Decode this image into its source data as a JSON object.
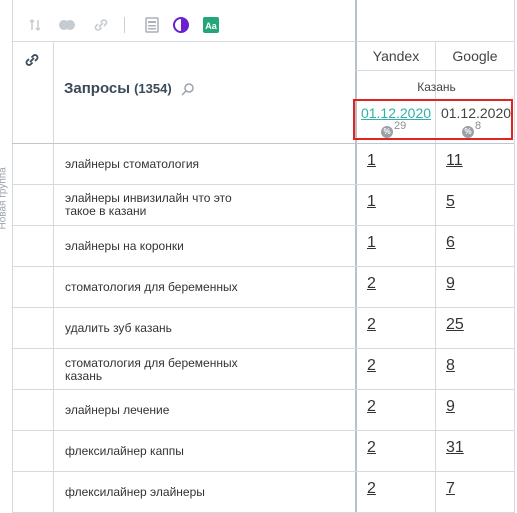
{
  "sidebar": {
    "group_label": "Новая группа"
  },
  "header": {
    "title": "Запросы",
    "count": "(1354)"
  },
  "engines": [
    {
      "label": "Yandex"
    },
    {
      "label": "Google"
    }
  ],
  "region": "Казань",
  "dates": [
    {
      "value": "01.12.2020",
      "percent_value": "29"
    },
    {
      "value": "01.12.2020",
      "percent_value": "8"
    }
  ],
  "percent_symbol": "%",
  "rows": [
    {
      "query": "элайнеры стоматология",
      "yandex": "1",
      "google": "11"
    },
    {
      "query": "элайнеры инвизилайн что это такое в казани",
      "yandex": "1",
      "google": "5"
    },
    {
      "query": "элайнеры на коронки",
      "yandex": "1",
      "google": "6"
    },
    {
      "query": "стоматология для беременных",
      "yandex": "2",
      "google": "9"
    },
    {
      "query": "удалить зуб казань",
      "yandex": "2",
      "google": "25"
    },
    {
      "query": "стоматология для беременных казань",
      "yandex": "2",
      "google": "8"
    },
    {
      "query": "элайнеры лечение",
      "yandex": "2",
      "google": "9"
    },
    {
      "query": "флексилайнер каппы",
      "yandex": "2",
      "google": "31"
    },
    {
      "query": "флексилайнер элайнеры",
      "yandex": "2",
      "google": "7"
    }
  ],
  "colors": {
    "accent": "#2fb0a8",
    "highlight_border": "#e02323",
    "grid": "#d4dae0"
  }
}
